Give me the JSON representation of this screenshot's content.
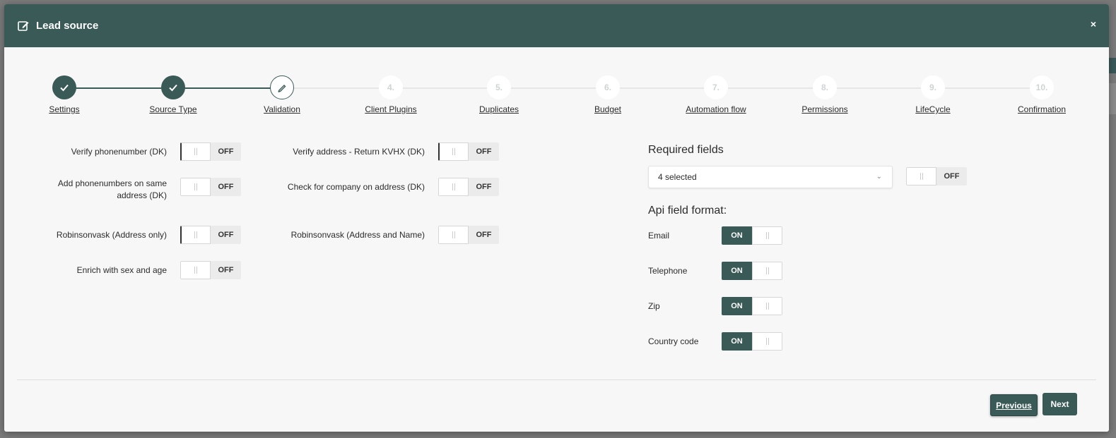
{
  "modal": {
    "title": "Lead source",
    "close_label": "×"
  },
  "steps": [
    {
      "label": "Settings",
      "marker": "",
      "status": "done"
    },
    {
      "label": "Source Type",
      "marker": "",
      "status": "done"
    },
    {
      "label": "Validation",
      "marker": "",
      "status": "active"
    },
    {
      "label": "Client Plugins",
      "marker": "4.",
      "status": "pending"
    },
    {
      "label": "Duplicates",
      "marker": "5.",
      "status": "pending"
    },
    {
      "label": "Budget",
      "marker": "6.",
      "status": "pending"
    },
    {
      "label": "Automation flow",
      "marker": "7.",
      "status": "pending"
    },
    {
      "label": "Permissions",
      "marker": "8.",
      "status": "pending"
    },
    {
      "label": "LifeCycle",
      "marker": "9.",
      "status": "pending"
    },
    {
      "label": "Confirmation",
      "marker": "10.",
      "status": "pending"
    }
  ],
  "validation_left": [
    {
      "label": "Verify phonenumber (DK)",
      "state": "OFF"
    },
    {
      "label": "Add phonenumbers on same address (DK)",
      "state": "OFF"
    },
    {
      "label": "Robinsonvask (Address only)",
      "state": "OFF"
    },
    {
      "label": "Enrich with sex and age",
      "state": "OFF"
    }
  ],
  "validation_middle": [
    {
      "label": "Verify address - Return KVHX (DK)",
      "state": "OFF"
    },
    {
      "label": "Check for company on address (DK)",
      "state": "OFF"
    },
    {
      "label": "Robinsonvask (Address and Name)",
      "state": "OFF"
    }
  ],
  "required_fields": {
    "title": "Required fields",
    "selected_value": "4 selected",
    "toggle_state": "OFF"
  },
  "api_field_format": {
    "title": "Api field format:",
    "fields": [
      {
        "label": "Email",
        "state": "ON"
      },
      {
        "label": "Telephone",
        "state": "ON"
      },
      {
        "label": "Zip",
        "state": "ON"
      },
      {
        "label": "Country code",
        "state": "ON"
      }
    ]
  },
  "footer": {
    "previous_label": "Previous",
    "next_label": "Next"
  },
  "colors": {
    "primary": "#3a5a58",
    "header_bg": "#3a5a58",
    "off_bg": "#ebebeb"
  }
}
